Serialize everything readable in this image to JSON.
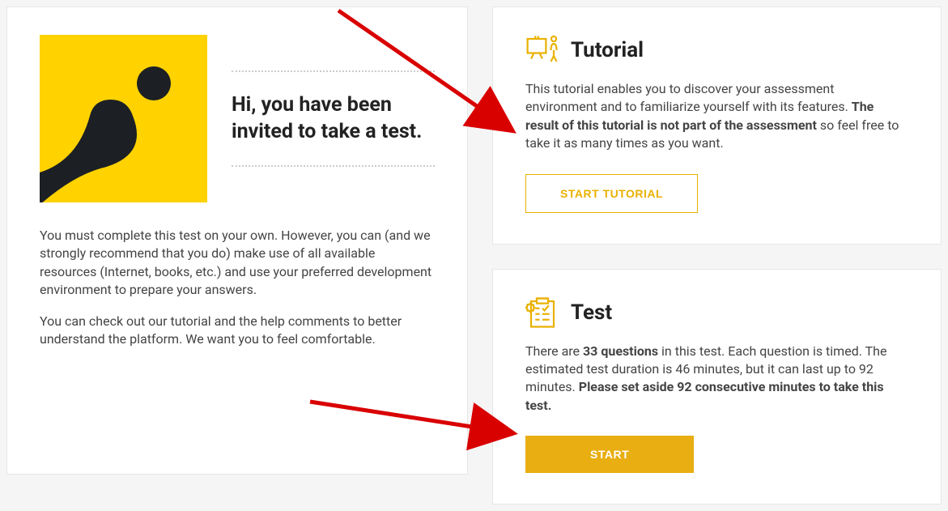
{
  "intro": {
    "heading": "Hi, you have been invited to take a test.",
    "p1": "You must complete this test on your own. However, you can (and we strongly recommend that you do) make use of all available resources (Internet, books, etc.) and use your preferred development environment to prepare your answers.",
    "p2": "You can check out our tutorial and the help comments to better understand the platform. We want you to feel comfortable."
  },
  "tutorial": {
    "title": "Tutorial",
    "desc_before": "This tutorial enables you to discover your assessment environment and to familiarize yourself with its features. ",
    "desc_bold": "The result of this tutorial is not part of the assessment",
    "desc_after": " so feel free to take it as many times as you want.",
    "button": "START TUTORIAL"
  },
  "test": {
    "title": "Test",
    "desc_p1_a": "There are ",
    "desc_p1_bold1": "33 questions",
    "desc_p1_b": " in this test. Each question is timed. The estimated test duration is 46 minutes, but it can last up to 92 minutes. ",
    "desc_p1_bold2": "Please set aside 92 consecutive minutes to take this test.",
    "button": "START"
  }
}
